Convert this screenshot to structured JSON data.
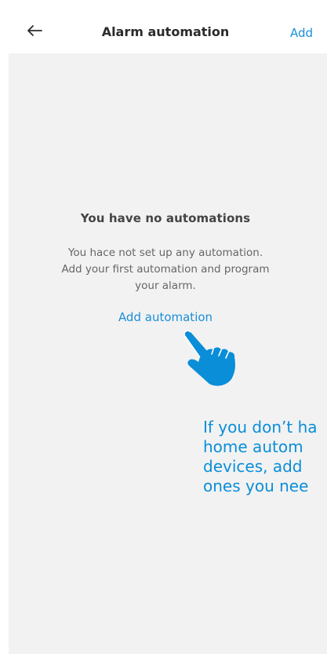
{
  "header": {
    "title": "Alarm automation",
    "add_label": "Add",
    "back_icon": "arrow-left-icon"
  },
  "empty_state": {
    "title": "You have no automations",
    "description_lines": [
      "You hace not set up any automation.",
      "Add your first automation and program",
      "your alarm."
    ],
    "cta_label": "Add automation"
  },
  "annotation": {
    "pointer_icon": "pointing-hand-icon",
    "lines": [
      "If you don’t ha",
      "home autom",
      "devices, add",
      "ones you nee"
    ]
  },
  "colors": {
    "accent": "#1a8fd9",
    "annotation": "#0a8ed8",
    "background": "#f2f2f2",
    "header_bg": "#ffffff"
  }
}
